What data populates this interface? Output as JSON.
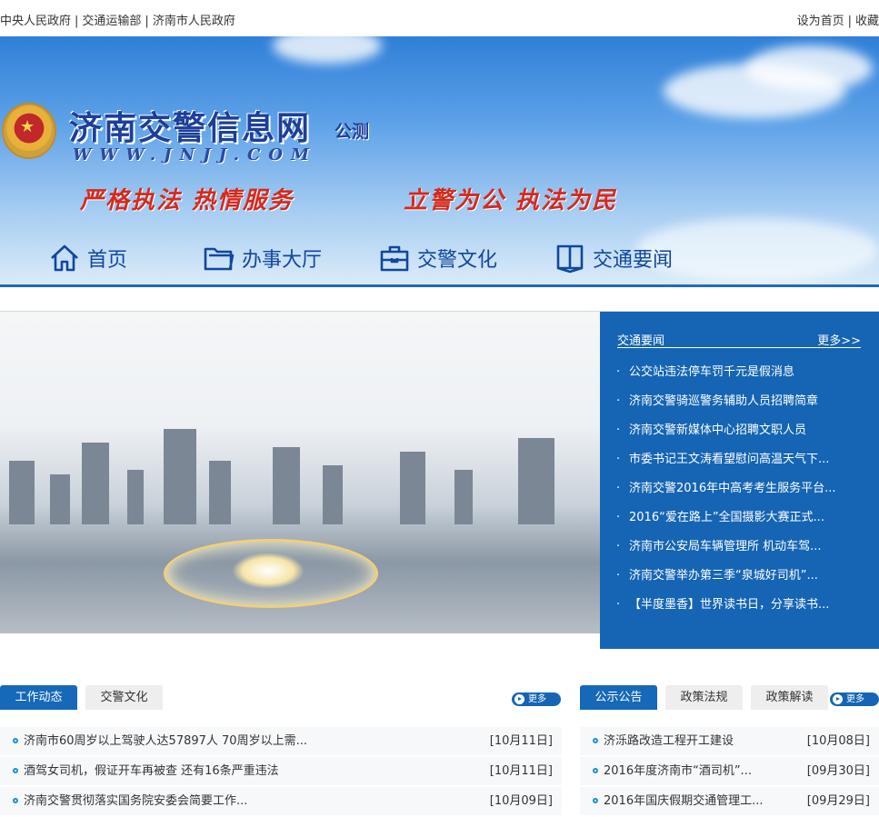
{
  "topbar": {
    "left_links": [
      "中央人民政府",
      "交通运输部",
      "济南市人民政府"
    ],
    "right_links": [
      "设为首页",
      "收藏"
    ]
  },
  "banner": {
    "title": "济南交警信息网",
    "tag": "公测",
    "domain": "WWW.JNJJ.COM",
    "slogan_left": "严格执法 热情服务",
    "slogan_right": "立警为公 执法为民"
  },
  "nav": {
    "items": [
      {
        "label": "首页",
        "icon": "home-icon"
      },
      {
        "label": "办事大厅",
        "icon": "folder-icon"
      },
      {
        "label": "交警文化",
        "icon": "briefcase-icon"
      },
      {
        "label": "交通要闻",
        "icon": "book-icon"
      }
    ]
  },
  "traffic_news": {
    "title": "交通要闻",
    "more": "更多>>",
    "items": [
      "公交站违法停车罚千元是假消息",
      "济南交警骑巡警务辅助人员招聘简章",
      "济南交警新媒体中心招聘文职人员",
      "市委书记王文涛看望慰问高温天气下...",
      "济南交警2016年中高考考生服务平台...",
      "2016“爱在路上”全国摄影大赛正式...",
      "济南市公安局车辆管理所 机动车驾...",
      "济南交警举办第三季“泉城好司机”...",
      "【半度墨香】世界读书日，分享读书..."
    ]
  },
  "left_section": {
    "tabs": [
      "工作动态",
      "交警文化"
    ],
    "more": "更多",
    "rows": [
      {
        "title": "济南市60周岁以上驾驶人达57897人 70周岁以上需...",
        "date": "[10月11日]"
      },
      {
        "title": "酒驾女司机，假证开车再被查 还有16条严重违法",
        "date": "[10月11日]"
      },
      {
        "title": "济南交警贯彻落实国务院安委会简要工作...",
        "date": "[10月09日]"
      }
    ]
  },
  "right_section": {
    "tabs": [
      "公示公告",
      "政策法规",
      "政策解读"
    ],
    "more": "更多",
    "rows": [
      {
        "title": "济泺路改造工程开工建设",
        "date": "[10月08日]"
      },
      {
        "title": "2016年度济南市“酒司机”...",
        "date": "[09月30日]"
      },
      {
        "title": "2016年国庆假期交通管理工...",
        "date": "[09月29日]"
      }
    ]
  }
}
